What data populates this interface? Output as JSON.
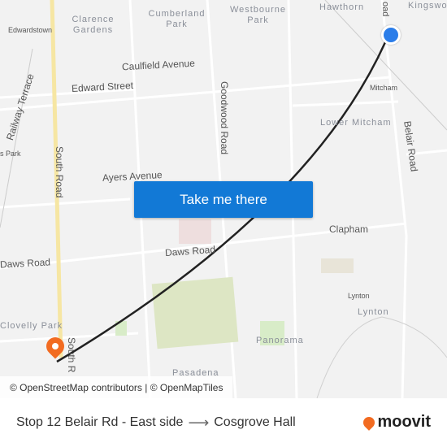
{
  "map": {
    "labels": {
      "hawthorn": "Hawthorn",
      "kingswood": "Kingswo",
      "road_top": "oad",
      "clarence": "Clarence Gardens",
      "cumberland": "Cumberland Park",
      "westbourne": "Westbourne Park",
      "edwardstown": "Edwardstown",
      "caulfield": "Caulfield Avenue",
      "edward": "Edward Street",
      "railway": "Railway Terrace",
      "goodwood": "Goodwood Road",
      "mitcham": "Mitcham",
      "lower_mitcham": "Lower Mitcham",
      "belair": "Belair Road",
      "south_road": "South Road",
      "south_road_bottom": "South R",
      "s_park": "s Park",
      "ayers": "Ayers Avenue",
      "clapham": "Clapham",
      "daws_left": "Daws Road",
      "daws": "Daws Road",
      "lynton_small": "Lynton",
      "lynton": "Lynton",
      "panorama": "Panorama",
      "clovelly": "Clovelly Park",
      "pasadena": "Pasadena"
    },
    "origin_color": "#2b7de9",
    "destination_color": "#f26b21",
    "route_color": "#222222"
  },
  "cta_label": "Take me there",
  "attribution": "© OpenStreetMap contributors | © OpenMapTiles",
  "footer": {
    "origin": "Stop 12 Belair Rd - East side",
    "arrow": "⟶",
    "destination": "Cosgrove Hall",
    "logo": "moovit"
  }
}
